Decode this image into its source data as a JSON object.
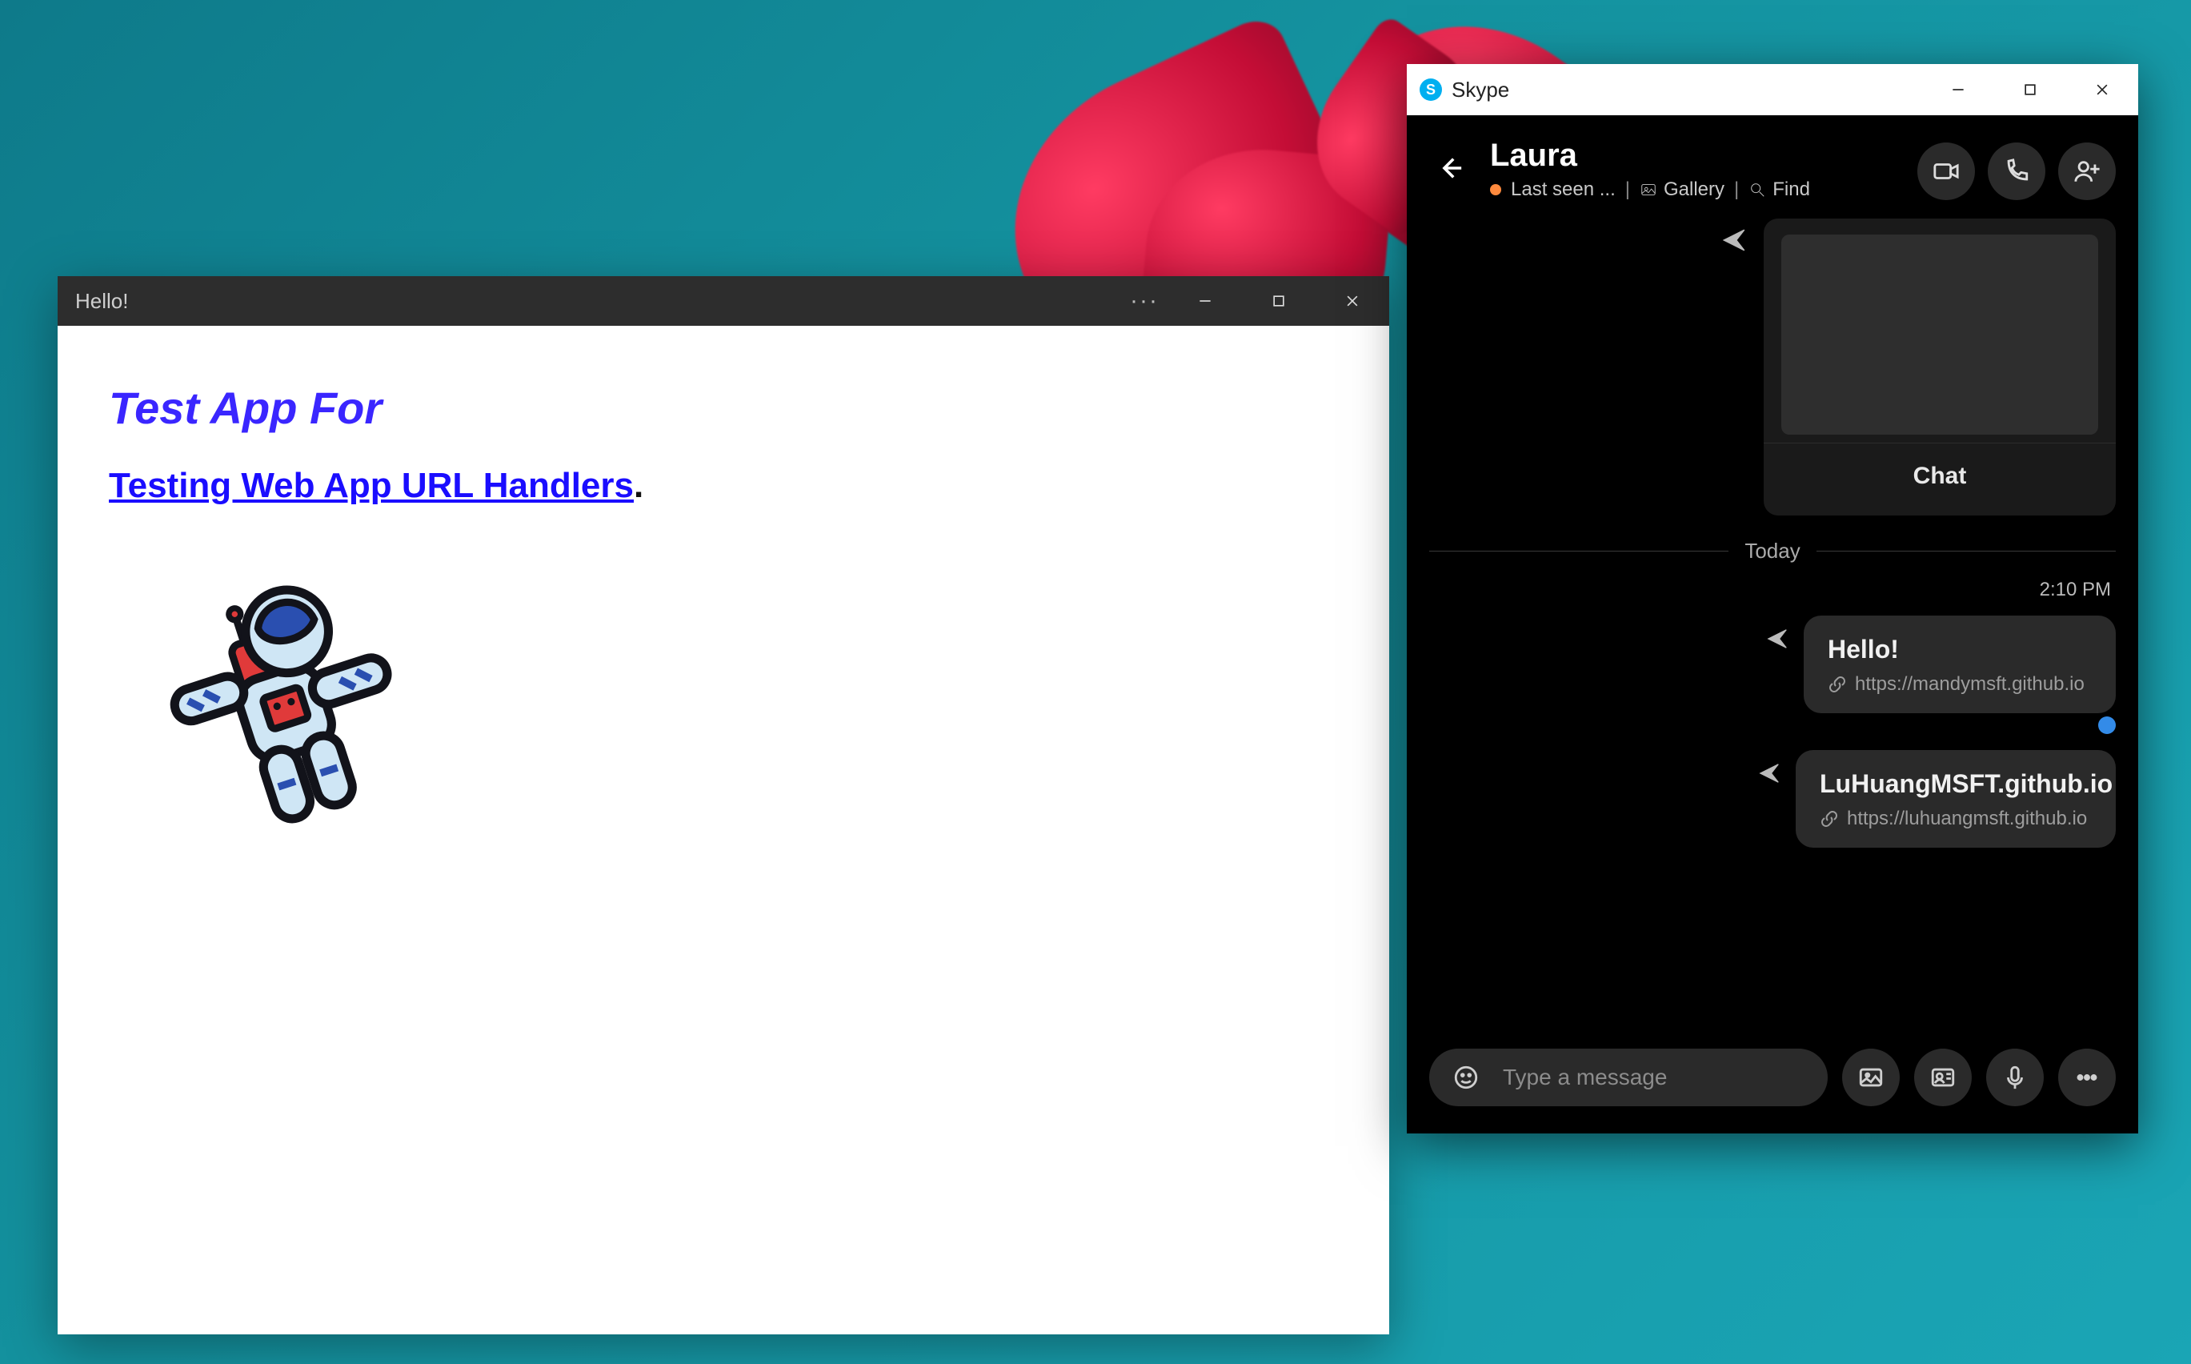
{
  "colors": {
    "accent_skype": "#00aff0",
    "link_blue": "#1a0dff"
  },
  "app_window": {
    "title": "Hello!",
    "heading": "Test App For",
    "subhead_link_text": "Testing Web App URL Handlers",
    "subhead_trailing": "."
  },
  "skype": {
    "titlebar": {
      "app_name": "Skype"
    },
    "contact": {
      "name": "Laura",
      "last_seen": "Last seen ...",
      "gallery_label": "Gallery",
      "find_label": "Find"
    },
    "preview_card": {
      "label": "Chat"
    },
    "date_divider": "Today",
    "timestamp": "2:10 PM",
    "messages": [
      {
        "title": "Hello!",
        "url": "https://mandymsft.github.io"
      },
      {
        "title": "LuHuangMSFT.github.io",
        "url": "https://luhuangmsft.github.io"
      }
    ],
    "compose": {
      "placeholder": "Type a message"
    }
  }
}
